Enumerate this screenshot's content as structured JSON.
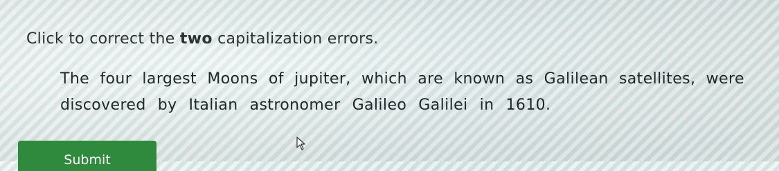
{
  "instruction": {
    "prefix": "Click to correct the ",
    "emphasis": "two",
    "suffix": " capitalization errors."
  },
  "passage": {
    "line1": [
      "The",
      "four",
      "largest",
      "Moons",
      "of",
      "jupiter,",
      "which",
      "are",
      "known",
      "as",
      "Galilean",
      "satellites,",
      "were"
    ],
    "line2": [
      "discovered",
      "by",
      "Italian",
      "astronomer",
      "Galileo",
      "Galilei",
      "in",
      "1610."
    ]
  },
  "submit": {
    "label": "Submit"
  },
  "colors": {
    "submit_bg": "#2f8a3e",
    "text": "#1f2828"
  }
}
